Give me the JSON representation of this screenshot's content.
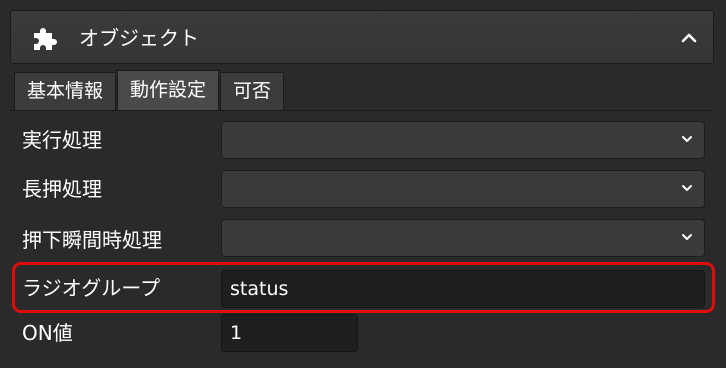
{
  "header": {
    "title": "オブジェクト",
    "icon": "puzzle-piece-icon",
    "collapse_icon": "chevron-up-icon"
  },
  "tabs": [
    {
      "label": "基本情報",
      "active": false
    },
    {
      "label": "動作設定",
      "active": true
    },
    {
      "label": "可否",
      "active": false
    }
  ],
  "fields": {
    "execute": {
      "label": "実行処理",
      "value": ""
    },
    "long_press": {
      "label": "長押処理",
      "value": ""
    },
    "press_moment": {
      "label": "押下瞬間時処理",
      "value": ""
    },
    "radio_group": {
      "label": "ラジオグループ",
      "value": "status"
    },
    "on_value": {
      "label": "ON値",
      "value": "1"
    }
  },
  "colors": {
    "highlight": "#e00d0d",
    "panel_bg": "#2a2a2a"
  }
}
